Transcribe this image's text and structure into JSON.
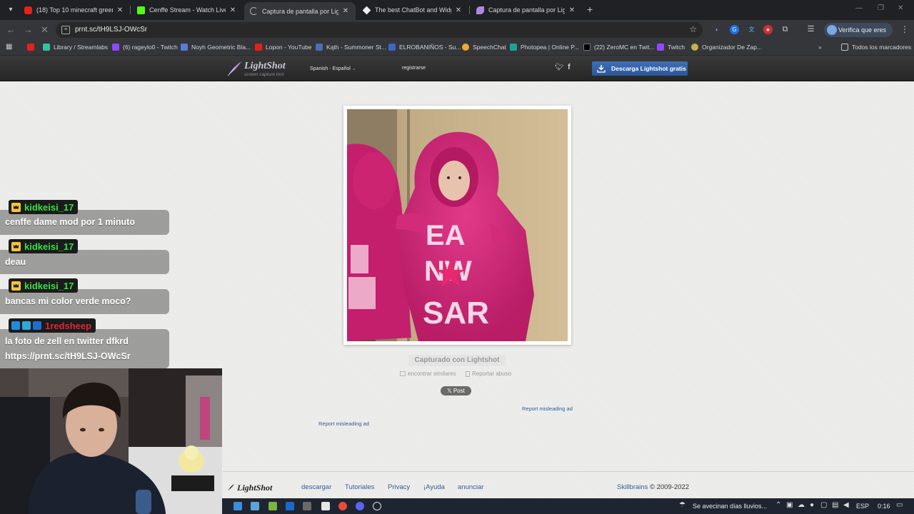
{
  "tabs": [
    {
      "title": "(18) Top 10 minecraft green scr",
      "active": false
    },
    {
      "title": "Cenffe Stream - Watch Live on",
      "active": false
    },
    {
      "title": "Captura de pantalla por Lightsh",
      "active": true
    },
    {
      "title": "The best ChatBot and Widgets",
      "active": false
    },
    {
      "title": "Captura de pantalla por Lightsh",
      "active": false
    }
  ],
  "omnibox": {
    "url": "prnt.sc/tH9LSJ-OWcSr"
  },
  "profile": {
    "label": "Verifica que eres tú"
  },
  "bookmarks": [
    {
      "label": "Library / Streamlabs"
    },
    {
      "label": "(6) rageylo0 - Twitch"
    },
    {
      "label": "Noyh Geometric Bla..."
    },
    {
      "label": "Lopon - YouTube"
    },
    {
      "label": "Kąth - Summoner St..."
    },
    {
      "label": "ELROBANIÑOS - Su..."
    },
    {
      "label": "SpeechChat"
    },
    {
      "label": "Photopea | Online P..."
    },
    {
      "label": "(22) ZeroMC en Twit..."
    },
    {
      "label": "Twitch"
    },
    {
      "label": "Organizador De Zap..."
    },
    {
      "label": "Todos los marcadores"
    }
  ],
  "lightshot": {
    "logo": "LightShot",
    "logo_sub": "screen capture tool",
    "language": "Spanish - Español",
    "register": "registrarse",
    "download": "Descarga Lightshot gratis",
    "captured": "Capturado con Lightshot",
    "similar": "encontrar similares",
    "abuse": "Reportar abuso",
    "post": "Post",
    "report_ad_1": "Report misleading ad",
    "report_ad_2": "Report misleading ad",
    "footer": {
      "logo": "LightShot",
      "links": [
        "descargar",
        "Tutoriales",
        "Privacy",
        "¡Ayuda",
        "anunciar"
      ],
      "company": "Skillbrains",
      "copyright": "© 2009-2022"
    }
  },
  "chat": [
    {
      "user": "kidkeisi_17",
      "text": [
        "cenffe dame mod por 1 minuto"
      ],
      "color": "#36e243"
    },
    {
      "user": "kidkeisi_17",
      "text": [
        "deau"
      ],
      "color": "#36e243"
    },
    {
      "user": "kidkeisi_17",
      "text": [
        "bancas mi color verde moco?"
      ],
      "color": "#36e243"
    },
    {
      "user": "1redsheep",
      "text": [
        "la foto de zell en twitter dfkrd",
        "https://prnt.sc/tH9LSJ-OWcSr"
      ],
      "color": "#e0243a"
    }
  ],
  "taskbar": {
    "weather": "Se avecinan días lluvios...",
    "lang": "ESP",
    "time": "0:16"
  }
}
